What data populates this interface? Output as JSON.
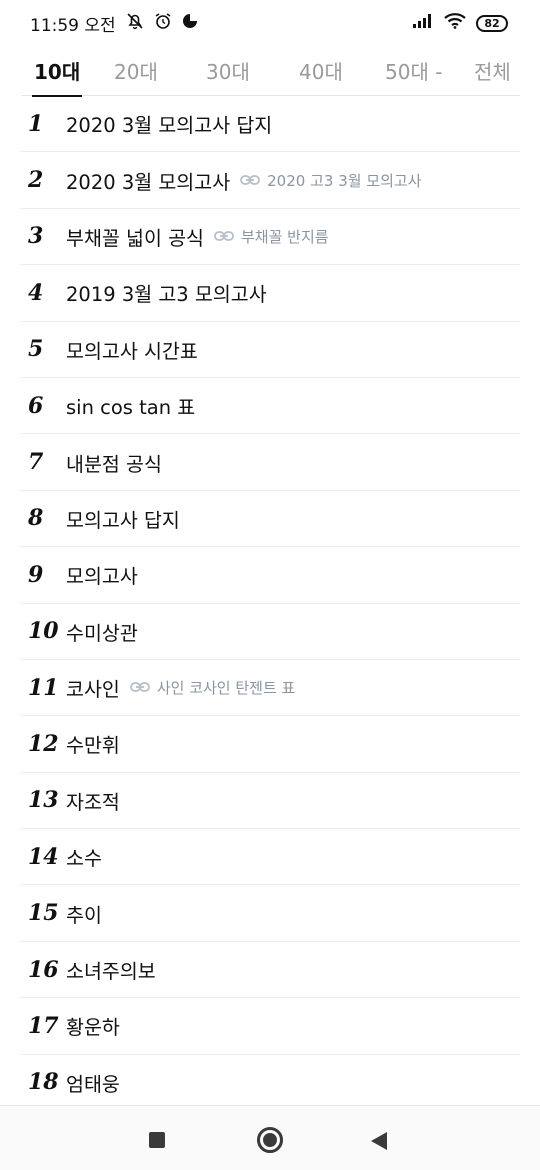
{
  "status_bar": {
    "time": "11:59 오전",
    "icons": [
      "mute-icon",
      "alarm-icon",
      "app-notification-icon"
    ],
    "signal": "signal-icon",
    "wifi": "wifi-icon",
    "battery": "82"
  },
  "tabs": [
    {
      "label": "10대",
      "active": true
    },
    {
      "label": "20대",
      "active": false
    },
    {
      "label": "30대",
      "active": false
    },
    {
      "label": "40대",
      "active": false
    },
    {
      "label": "50대 -",
      "active": false
    },
    {
      "label": "전체",
      "active": false
    }
  ],
  "rankings": [
    {
      "rank": "1",
      "keyword": "2020 3월 모의고사 답지",
      "related": ""
    },
    {
      "rank": "2",
      "keyword": "2020 3월 모의고사",
      "related": "2020 고3 3월 모의고사"
    },
    {
      "rank": "3",
      "keyword": "부채꼴 넓이 공식",
      "related": "부채꼴 반지름"
    },
    {
      "rank": "4",
      "keyword": "2019 3월 고3 모의고사",
      "related": ""
    },
    {
      "rank": "5",
      "keyword": "모의고사 시간표",
      "related": ""
    },
    {
      "rank": "6",
      "keyword": "sin cos tan 표",
      "related": ""
    },
    {
      "rank": "7",
      "keyword": "내분점 공식",
      "related": ""
    },
    {
      "rank": "8",
      "keyword": "모의고사 답지",
      "related": ""
    },
    {
      "rank": "9",
      "keyword": "모의고사",
      "related": ""
    },
    {
      "rank": "10",
      "keyword": "수미상관",
      "related": ""
    },
    {
      "rank": "11",
      "keyword": "코사인",
      "related": "사인 코사인 탄젠트 표"
    },
    {
      "rank": "12",
      "keyword": "수만휘",
      "related": ""
    },
    {
      "rank": "13",
      "keyword": "자조적",
      "related": ""
    },
    {
      "rank": "14",
      "keyword": "소수",
      "related": ""
    },
    {
      "rank": "15",
      "keyword": "추이",
      "related": ""
    },
    {
      "rank": "16",
      "keyword": "소녀주의보",
      "related": ""
    },
    {
      "rank": "17",
      "keyword": "황운하",
      "related": ""
    },
    {
      "rank": "18",
      "keyword": "엄태웅",
      "related": ""
    }
  ],
  "nav_bar": {
    "recent": "recent-apps-icon",
    "home": "home-icon",
    "back": "back-icon"
  }
}
